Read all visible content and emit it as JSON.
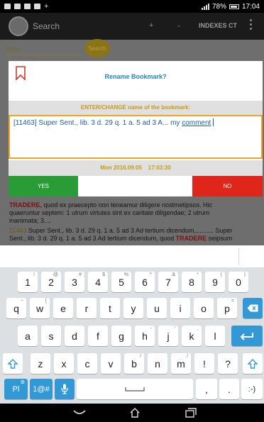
{
  "status_bar": {
    "battery_percent": "78%",
    "time": "17:04"
  },
  "action_bar": {
    "search_label": "Search",
    "plus_label": "+",
    "minus_label": "-",
    "indexes_label": "INDEXES CT"
  },
  "background": {
    "index_placeholder": "Index",
    "search_button_label": "Search",
    "lines": {
      "line1_num": "11463",
      "line1_text": " Super Sent., lib. 3 d. 29 q. 1 a. 5 ad 3 Ad tertium dicendum,.......... Super",
      "line2_text": "Sent., lib. 3 d. 29 q. 1 a. 5 ad 3 Ad tertium dicendum, quod ",
      "line2_red": "TRADERE",
      "line2_after": " seipsum",
      "red_word_top": "TRADERE",
      "top_line1_after": ", quod ex praecepto non teneamur diligere nostmetipsos. Hic",
      "top_line2": "quaeruntur septem: 1 utrum virtutes sint ex caritate diligendae; 2 utrum",
      "top_line3": "inanimata; 3...."
    }
  },
  "dialog": {
    "title": "Rename Bookmark?",
    "subtitle": "ENTER/CHANGE name of the bookmark:",
    "input_text_before": "[11463] Super Sent., lib. 3 d. 29 q. 1 a. 5 ad 3 A... my ",
    "input_text_underlined": "comment",
    "date": "Mon 2016.09.05",
    "time": "17:03:30",
    "yes_label": "YES",
    "no_label": "NO"
  },
  "keyboard": {
    "row1": [
      {
        "k": "1",
        "h": "!"
      },
      {
        "k": "2",
        "h": "@"
      },
      {
        "k": "3",
        "h": "#"
      },
      {
        "k": "4",
        "h": "$"
      },
      {
        "k": "5",
        "h": "%"
      },
      {
        "k": "6",
        "h": "^"
      },
      {
        "k": "7",
        "h": "&"
      },
      {
        "k": "8",
        "h": "*"
      },
      {
        "k": "9",
        "h": "("
      },
      {
        "k": "0",
        "h": ")"
      }
    ],
    "row2": [
      {
        "k": "q",
        "h": "~"
      },
      {
        "k": "w",
        "h": "["
      },
      {
        "k": "e",
        "h": ""
      },
      {
        "k": "r",
        "h": ""
      },
      {
        "k": "t",
        "h": ""
      },
      {
        "k": "y",
        "h": ""
      },
      {
        "k": "u",
        "h": ""
      },
      {
        "k": "i",
        "h": ""
      },
      {
        "k": "o",
        "h": ""
      },
      {
        "k": "p",
        "h": "="
      }
    ],
    "row3": [
      {
        "k": "a",
        "h": ""
      },
      {
        "k": "s",
        "h": ""
      },
      {
        "k": "d",
        "h": ""
      },
      {
        "k": "f",
        "h": ""
      },
      {
        "k": "g",
        "h": ""
      },
      {
        "k": "h",
        "h": "-"
      },
      {
        "k": "j",
        "h": "'"
      },
      {
        "k": "k",
        "h": ","
      },
      {
        "k": "l",
        "h": ""
      }
    ],
    "row4": [
      {
        "k": "z",
        "h": ""
      },
      {
        "k": "x",
        "h": ""
      },
      {
        "k": "c",
        "h": ""
      },
      {
        "k": "v",
        "h": ""
      },
      {
        "k": "b",
        "h": "/"
      },
      {
        "k": "n",
        "h": ""
      },
      {
        "k": "m",
        "h": "/"
      },
      {
        "k": "!",
        "h": ""
      },
      {
        "k": "?",
        "h": ""
      }
    ],
    "lang_label": "Pl",
    "sym_label": "1@#",
    "comma_label": ",",
    "period_label": ".",
    "smiley_label": ":-)"
  },
  "icons": {
    "backspace": "backspace-icon",
    "enter": "enter-icon",
    "shift": "shift-icon",
    "mic": "mic-icon",
    "space": "space-icon",
    "nav_back": "back-icon",
    "nav_home": "home-icon",
    "nav_recents": "recents-icon"
  },
  "colors": {
    "yes": "#2a9c37",
    "no": "#e0251b",
    "accent_gold": "#c79a16",
    "title_blue": "#1e88c6",
    "key_blue": "#3399d6"
  }
}
